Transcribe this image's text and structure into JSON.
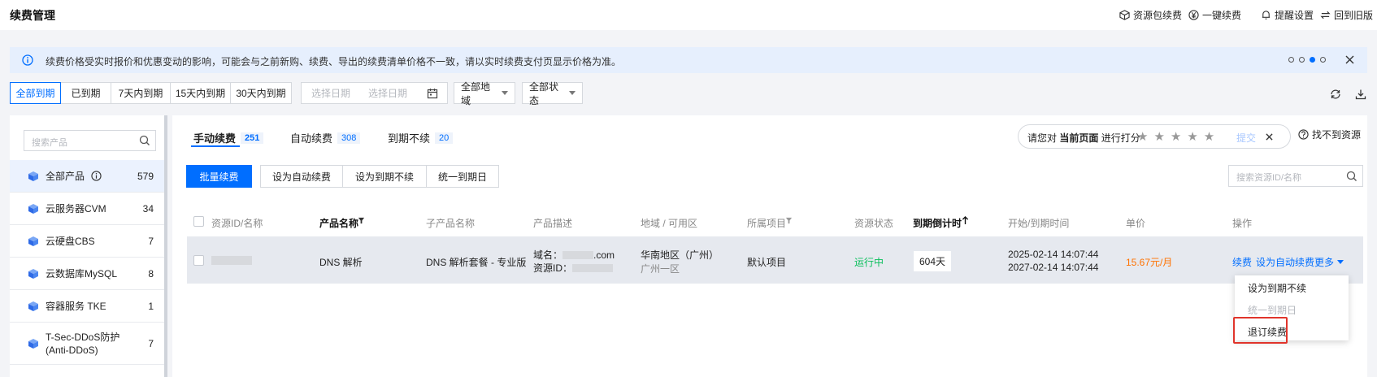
{
  "header": {
    "title": "续费管理",
    "links": [
      "资源包续费",
      "一键续费",
      "提醒设置",
      "回到旧版"
    ]
  },
  "notice": {
    "text": "续费价格受实时报价和优惠变动的影响，可能会与之前新购、续费、导出的续费清单价格不一致，请以实时续费支付页显示价格为准。",
    "pager_active_index": 2
  },
  "filters": {
    "segments": [
      "全部到期",
      "已到期",
      "7天内到期",
      "15天内到期",
      "30天内到期"
    ],
    "active_segment": 0,
    "date_start_placeholder": "选择日期",
    "date_end_placeholder": "选择日期",
    "region": "全部地域",
    "status": "全部状态"
  },
  "sidebar": {
    "search_placeholder": "搜索产品",
    "items": [
      {
        "label": "全部产品",
        "count": "579",
        "active": true,
        "info": true
      },
      {
        "label": "云服务器CVM",
        "count": "34"
      },
      {
        "label": "云硬盘CBS",
        "count": "7"
      },
      {
        "label": "云数据库MySQL",
        "count": "8"
      },
      {
        "label": "容器服务 TKE",
        "count": "1"
      },
      {
        "label": "T-Sec-DDoS防护(Anti-DDoS)",
        "count": "7"
      }
    ]
  },
  "tabs": [
    {
      "label": "手动续费",
      "count": "251",
      "active": true
    },
    {
      "label": "自动续费",
      "count": "308"
    },
    {
      "label": "到期不续",
      "count": "20"
    }
  ],
  "rating": {
    "prefix": "请您对",
    "emph": "当前页面",
    "suffix": "进行打分",
    "submit": "提交",
    "help": "找不到资源"
  },
  "actions": {
    "batch": "批量续费",
    "set_auto": "设为自动续费",
    "set_no_renew": "设为到期不续",
    "unify": "统一到期日",
    "search_placeholder": "搜索资源ID/名称"
  },
  "table": {
    "headers": {
      "id": "资源ID/名称",
      "product": "产品名称",
      "subproduct": "子产品名称",
      "desc": "产品描述",
      "region": "地域 / 可用区",
      "project": "所属项目",
      "status": "资源状态",
      "countdown": "到期倒计时",
      "time": "开始/到期时间",
      "price": "单价",
      "ops": "操作"
    },
    "row": {
      "product": "DNS 解析",
      "subproduct": "DNS 解析套餐 - 专业版",
      "desc_domain_prefix": "域名：",
      "desc_domain_suffix": ".com",
      "desc_id_prefix": "资源ID：",
      "region": "华南地区（广州）",
      "zone": "广州一区",
      "project": "默认项目",
      "status": "运行中",
      "countdown": "604天",
      "start": "2025-02-14 14:07:44",
      "end": "2027-02-14 14:07:44",
      "price": "15.67元/月",
      "op_renew": "续费",
      "op_auto": "设为自动续费",
      "op_more": "更多"
    }
  },
  "menu": {
    "items": [
      "设为到期不续",
      "统一到期日",
      "退订续费"
    ]
  },
  "colors": {
    "primary": "#006eff",
    "running": "#0abf5b",
    "price": "#ff7200",
    "highlight": "#e0342b"
  }
}
